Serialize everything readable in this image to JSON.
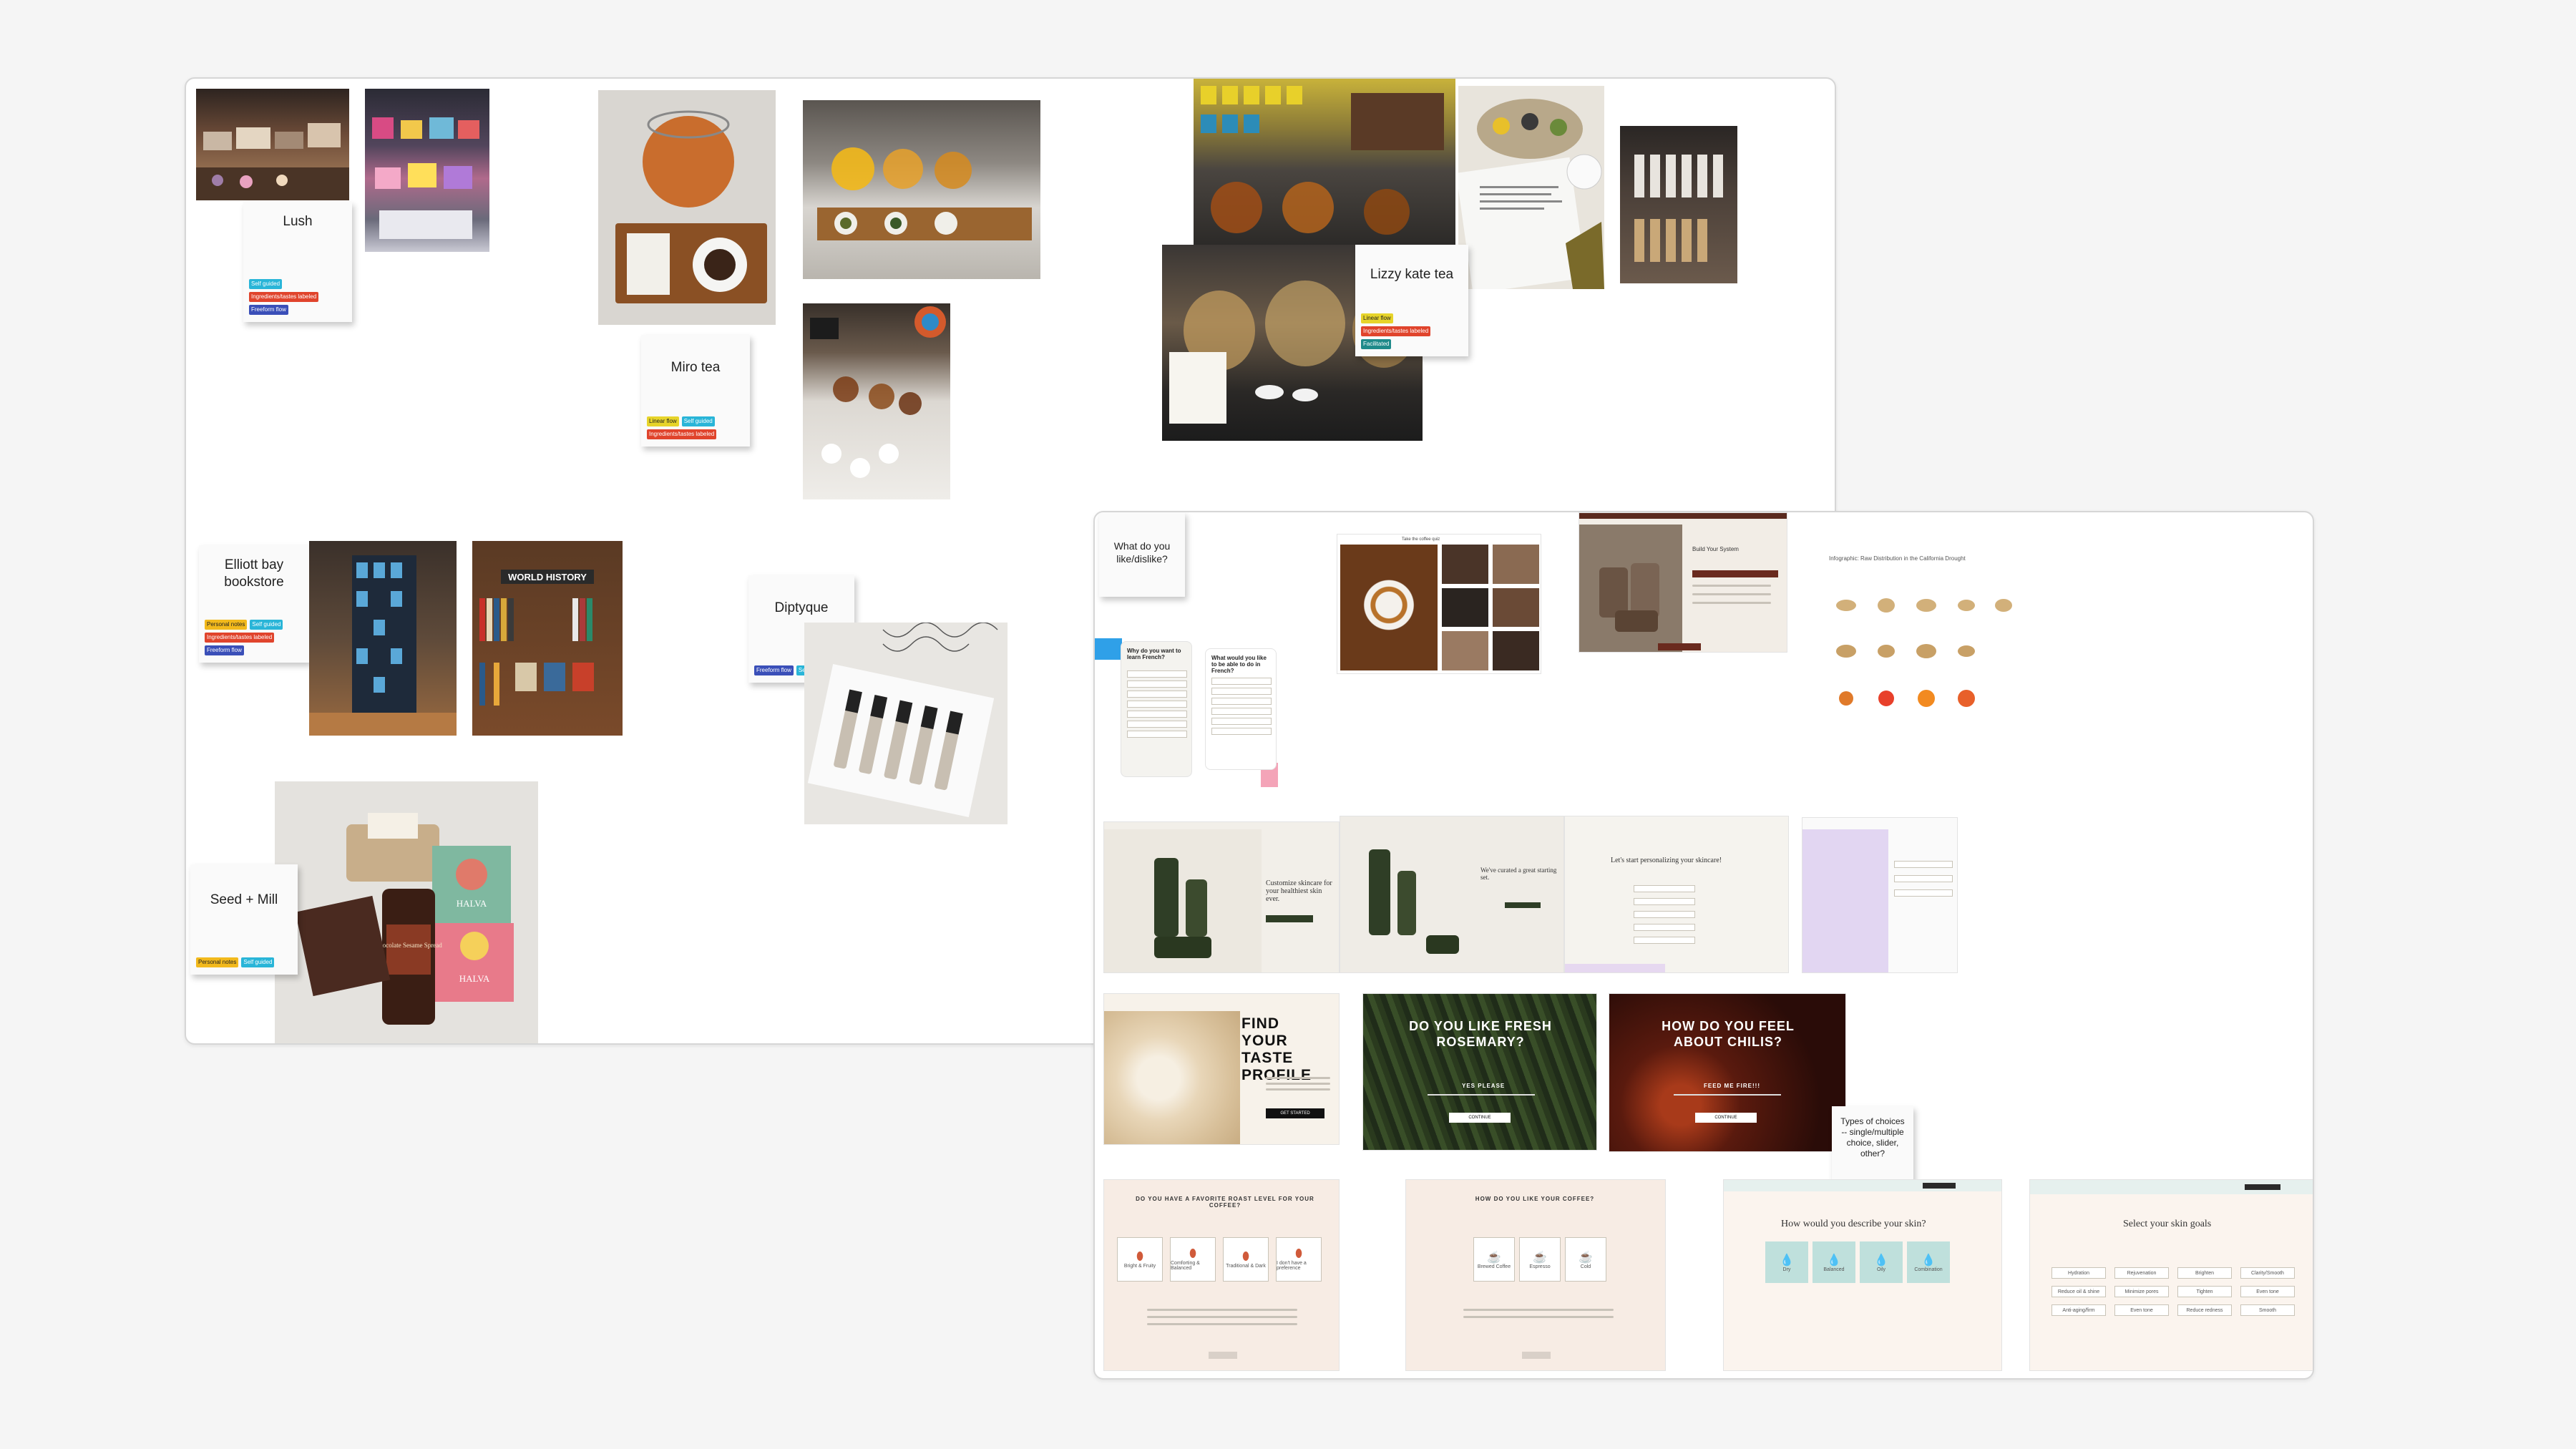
{
  "stickies": {
    "lush": {
      "title": "Lush",
      "tags": [
        "Self guided",
        "Ingredients/tastes labeled",
        "Freeform flow"
      ]
    },
    "miro": {
      "title": "Miro tea",
      "tags": [
        "Linear flow",
        "Self guided",
        "Ingredients/tastes labeled"
      ]
    },
    "lizzy": {
      "title": "Lizzy kate tea",
      "tags": [
        "Linear flow",
        "Ingredients/tastes labeled",
        "Facilitated"
      ]
    },
    "elliott": {
      "title": "Elliott bay bookstore",
      "tags": [
        "Personal notes",
        "Self guided",
        "Ingredients/tastes labeled",
        "Freeform flow"
      ]
    },
    "diptyque": {
      "title": "Diptyque",
      "tags": [
        "Freeform flow",
        "Self guided"
      ]
    },
    "seed": {
      "title": "Seed + Mill",
      "tags": [
        "Personal notes",
        "Self guided"
      ]
    },
    "question": {
      "title": "What do you like/dislike?"
    },
    "types": {
      "title": "Types of choices -- single/multiple choice, slider, other?"
    }
  },
  "tag_colors": {
    "Self guided": "#29b5d8",
    "Ingredients/tastes labeled": "#e0442c",
    "Freeform flow": "#3a4fb8",
    "Linear flow": "#e7d42a",
    "Facilitated": "#1f8a8a",
    "Personal notes": "#f2b91c"
  },
  "photo_labels": {
    "world_history": "WORLD HISTORY",
    "halva1": "HALVA",
    "halva2": "HALVA",
    "chocolate": "Chocolate Sesame Spread"
  },
  "screens": {
    "find_taste": {
      "title": "FIND YOUR TASTE PROFILE",
      "button": "GET STARTED"
    },
    "rosemary": {
      "title": "DO YOU LIKE FRESH ROSEMARY?",
      "answer": "YES PLEASE",
      "button": "CONTINUE"
    },
    "chilis": {
      "title": "HOW DO YOU FEEL ABOUT CHILIS?",
      "answer": "FEED ME FIRE!!!",
      "button": "CONTINUE"
    },
    "roast": {
      "title": "DO YOU HAVE A FAVORITE ROAST LEVEL FOR YOUR COFFEE?",
      "options": [
        "Bright & Fruity",
        "Comforting & Balanced",
        "Traditional & Dark",
        "I don't have a preference"
      ]
    },
    "coffee_like": {
      "title": "HOW DO YOU LIKE YOUR COFFEE?",
      "options": [
        "Brewed Coffee",
        "Espresso",
        "Cold"
      ]
    },
    "skin": {
      "title": "How would you describe your skin?",
      "options": [
        "Dry",
        "Balanced",
        "Oily",
        "Combination"
      ]
    },
    "skin_goals": {
      "title": "Select your skin goals",
      "options": [
        "Hydration",
        "Rejuvenation",
        "Brighten",
        "Clarity/Smooth",
        "Reduce oil & shine",
        "Minimize pores",
        "Tighten",
        "Even tone",
        "Anti-aging/firm",
        "Even tone",
        "Reduce redness",
        "Smooth"
      ]
    },
    "skincare_cust": {
      "title": "Customize skincare for your healthiest skin ever."
    },
    "skincare_start": {
      "title": "Let's start personalizing your skincare!"
    },
    "skincare_rec": {
      "title": "We've curated a great starting set."
    },
    "build_system": {
      "title": "Build Your System"
    },
    "infographic": {
      "title": "Infographic: Raw Distribution in the California Drought"
    },
    "recipe_qs": {
      "title": "Why do you want to learn French?"
    },
    "recipe_qs2": {
      "title": "What would you like to be able to do in French?"
    },
    "coffee_mag": {
      "title": "Take the coffee quiz"
    }
  }
}
